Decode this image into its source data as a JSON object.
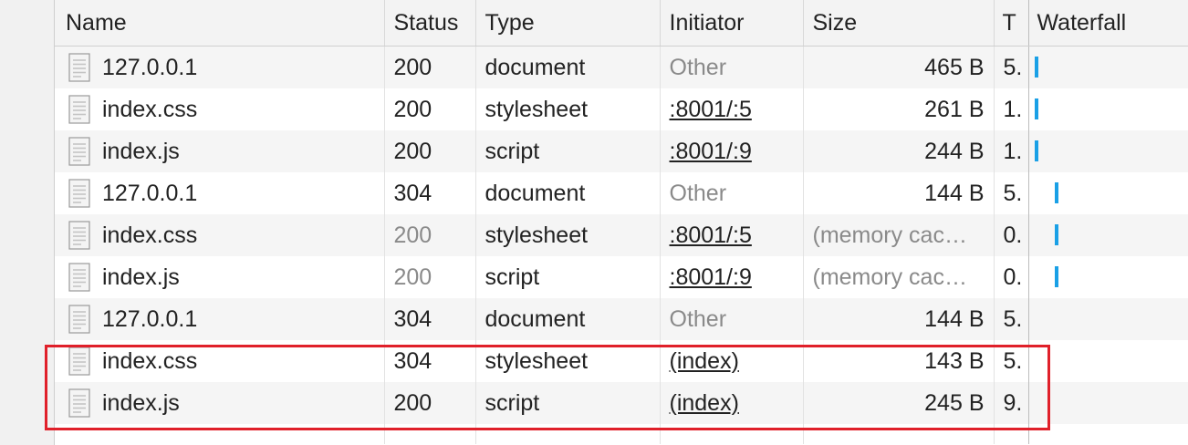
{
  "columns": {
    "name": "Name",
    "status": "Status",
    "type": "Type",
    "initiator": "Initiator",
    "size": "Size",
    "time": "T",
    "waterfall": "Waterfall"
  },
  "icons": {
    "file": "document-file-icon"
  },
  "colors": {
    "waterfall_bar": "#1aa0e6",
    "highlight": "#e0202a"
  },
  "rows": [
    {
      "name": "127.0.0.1",
      "status": "200",
      "type": "document",
      "initiator": "Other",
      "size": "465 B",
      "time": "5.",
      "waterfall": true
    },
    {
      "name": "index.css",
      "status": "200",
      "type": "stylesheet",
      "initiator": ":8001/:5",
      "size": "261 B",
      "time": "1.",
      "waterfall": true
    },
    {
      "name": "index.js",
      "status": "200",
      "type": "script",
      "initiator": ":8001/:9",
      "size": "244 B",
      "time": "1.",
      "waterfall": true
    },
    {
      "name": "127.0.0.1",
      "status": "304",
      "type": "document",
      "initiator": "Other",
      "size": "144 B",
      "time": "5.",
      "waterfall": true
    },
    {
      "name": "index.css",
      "status": "200",
      "type": "stylesheet",
      "initiator": ":8001/:5",
      "size": "(memory cac…",
      "time": "0.",
      "waterfall": true
    },
    {
      "name": "index.js",
      "status": "200",
      "type": "script",
      "initiator": ":8001/:9",
      "size": "(memory cac…",
      "time": "0.",
      "waterfall": true
    },
    {
      "name": "127.0.0.1",
      "status": "304",
      "type": "document",
      "initiator": "Other",
      "size": "144 B",
      "time": "5.",
      "waterfall": false
    },
    {
      "name": "index.css",
      "status": "304",
      "type": "stylesheet",
      "initiator": "(index)",
      "size": "143 B",
      "time": "5.",
      "waterfall": false
    },
    {
      "name": "index.js",
      "status": "200",
      "type": "script",
      "initiator": "(index)",
      "size": "245 B",
      "time": "9.",
      "waterfall": false
    }
  ]
}
